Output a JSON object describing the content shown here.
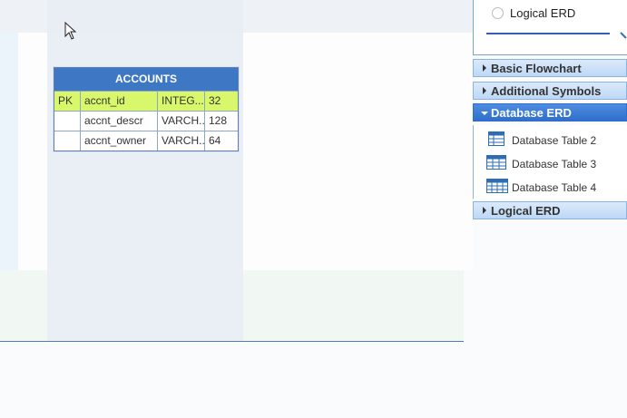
{
  "canvas": {
    "table": {
      "title": "ACCOUNTS",
      "rows": [
        {
          "key": "PK",
          "name": "accnt_id",
          "type": "INTEG...",
          "length": "32",
          "is_pk": true
        },
        {
          "key": "",
          "name": "accnt_descr",
          "type": "VARCH...",
          "length": "128",
          "is_pk": false
        },
        {
          "key": "",
          "name": "accnt_owner",
          "type": "VARCH...",
          "length": "64",
          "is_pk": false
        }
      ],
      "colors": {
        "header": "#3e78c4",
        "pk_row": "#d9f76a"
      }
    }
  },
  "sidebar": {
    "top_option": {
      "label": "Logical ERD",
      "icon": "radio-icon"
    },
    "sections": [
      {
        "label": "Basic Flowchart",
        "expanded": false
      },
      {
        "label": "Additional Symbols",
        "expanded": false
      },
      {
        "label": "Database ERD",
        "expanded": true
      },
      {
        "label": "Logical ERD",
        "expanded": false
      }
    ],
    "database_erd_items": [
      {
        "label": "Database Table 2",
        "icon": "table-icon"
      },
      {
        "label": "Database Table 3",
        "icon": "table-icon"
      },
      {
        "label": "Database Table 4",
        "icon": "table-icon"
      }
    ]
  }
}
